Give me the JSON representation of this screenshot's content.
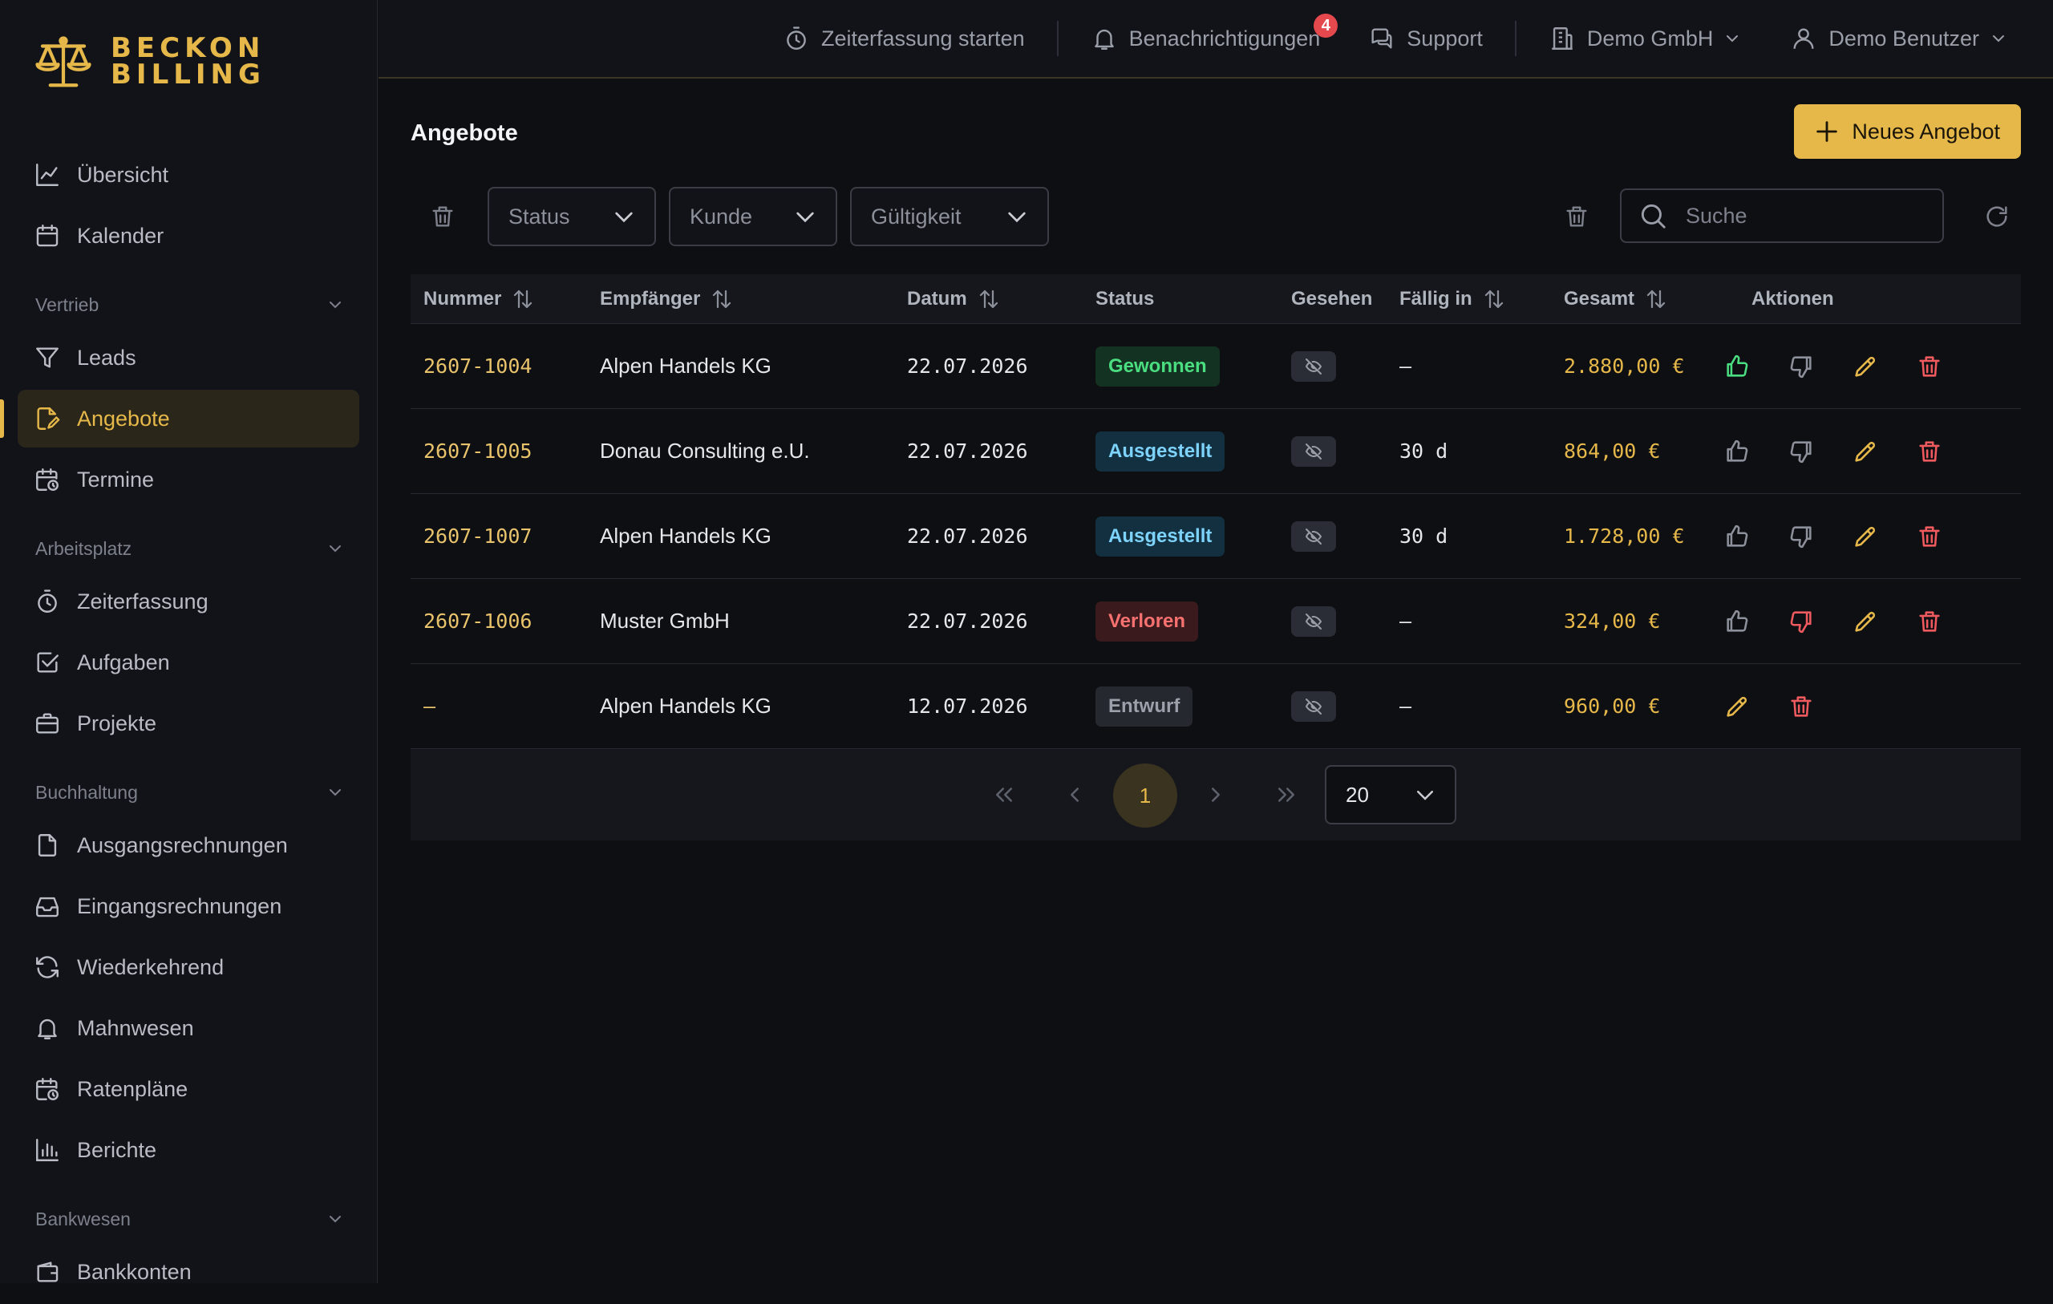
{
  "brand": {
    "line1": "BECKON",
    "line2": "BILLING",
    "accent": "#e6b84a"
  },
  "topbar": {
    "timer": "Zeiterfassung starten",
    "notifications": "Benachrichtigungen",
    "notifications_count": "4",
    "support": "Support",
    "company": "Demo GmbH",
    "user": "Demo Benutzer"
  },
  "sidebar": {
    "top": [
      {
        "label": "Übersicht",
        "icon": "chart-line-icon"
      },
      {
        "label": "Kalender",
        "icon": "calendar-icon"
      }
    ],
    "sections": {
      "vertrieb": "Vertrieb",
      "arbeitsplatz": "Arbeitsplatz",
      "buchhaltung": "Buchhaltung",
      "bankwesen": "Bankwesen"
    },
    "vertrieb": [
      {
        "label": "Leads",
        "icon": "funnel-icon"
      },
      {
        "label": "Angebote",
        "icon": "document-edit-icon",
        "active": true
      },
      {
        "label": "Termine",
        "icon": "calendar-clock-icon"
      }
    ],
    "arbeitsplatz": [
      {
        "label": "Zeiterfassung",
        "icon": "stopwatch-icon"
      },
      {
        "label": "Aufgaben",
        "icon": "checkbox-icon"
      },
      {
        "label": "Projekte",
        "icon": "briefcase-icon"
      }
    ],
    "buchhaltung": [
      {
        "label": "Ausgangsrechnungen",
        "icon": "file-icon"
      },
      {
        "label": "Eingangsrechnungen",
        "icon": "inbox-icon"
      },
      {
        "label": "Wiederkehrend",
        "icon": "refresh-icon"
      },
      {
        "label": "Mahnwesen",
        "icon": "bell-icon"
      },
      {
        "label": "Ratenpläne",
        "icon": "calendar-clock-icon"
      },
      {
        "label": "Berichte",
        "icon": "bar-chart-icon"
      }
    ],
    "bankwesen": [
      {
        "label": "Bankkonten",
        "icon": "wallet-icon"
      }
    ]
  },
  "page": {
    "title": "Angebote",
    "new_button": "Neues Angebot",
    "filters": {
      "status": "Status",
      "kunde": "Kunde",
      "gueltigkeit": "Gültigkeit"
    },
    "search_placeholder": "Suche"
  },
  "table": {
    "columns": {
      "nummer": "Nummer",
      "empfaenger": "Empfänger",
      "datum": "Datum",
      "status": "Status",
      "gesehen": "Gesehen",
      "faellig": "Fällig in",
      "gesamt": "Gesamt",
      "aktionen": "Aktionen"
    },
    "rows": [
      {
        "nummer": "2607-1004",
        "empfaenger": "Alpen Handels KG",
        "datum": "22.07.2026",
        "status": "Gewonnen",
        "status_kind": "won",
        "faellig": "–",
        "gesamt": "2.880,00 €"
      },
      {
        "nummer": "2607-1005",
        "empfaenger": "Donau Consulting e.U.",
        "datum": "22.07.2026",
        "status": "Ausgestellt",
        "status_kind": "issued",
        "faellig": "30 d",
        "gesamt": "864,00 €"
      },
      {
        "nummer": "2607-1007",
        "empfaenger": "Alpen Handels KG",
        "datum": "22.07.2026",
        "status": "Ausgestellt",
        "status_kind": "issued",
        "faellig": "30 d",
        "gesamt": "1.728,00 €"
      },
      {
        "nummer": "2607-1006",
        "empfaenger": "Muster GmbH",
        "datum": "22.07.2026",
        "status": "Verloren",
        "status_kind": "lost",
        "faellig": "–",
        "gesamt": "324,00 €"
      },
      {
        "nummer": "–",
        "empfaenger": "Alpen Handels KG",
        "datum": "12.07.2026",
        "status": "Entwurf",
        "status_kind": "draft",
        "faellig": "–",
        "gesamt": "960,00 €"
      }
    ]
  },
  "pagination": {
    "current_page": "1",
    "page_size": "20"
  }
}
